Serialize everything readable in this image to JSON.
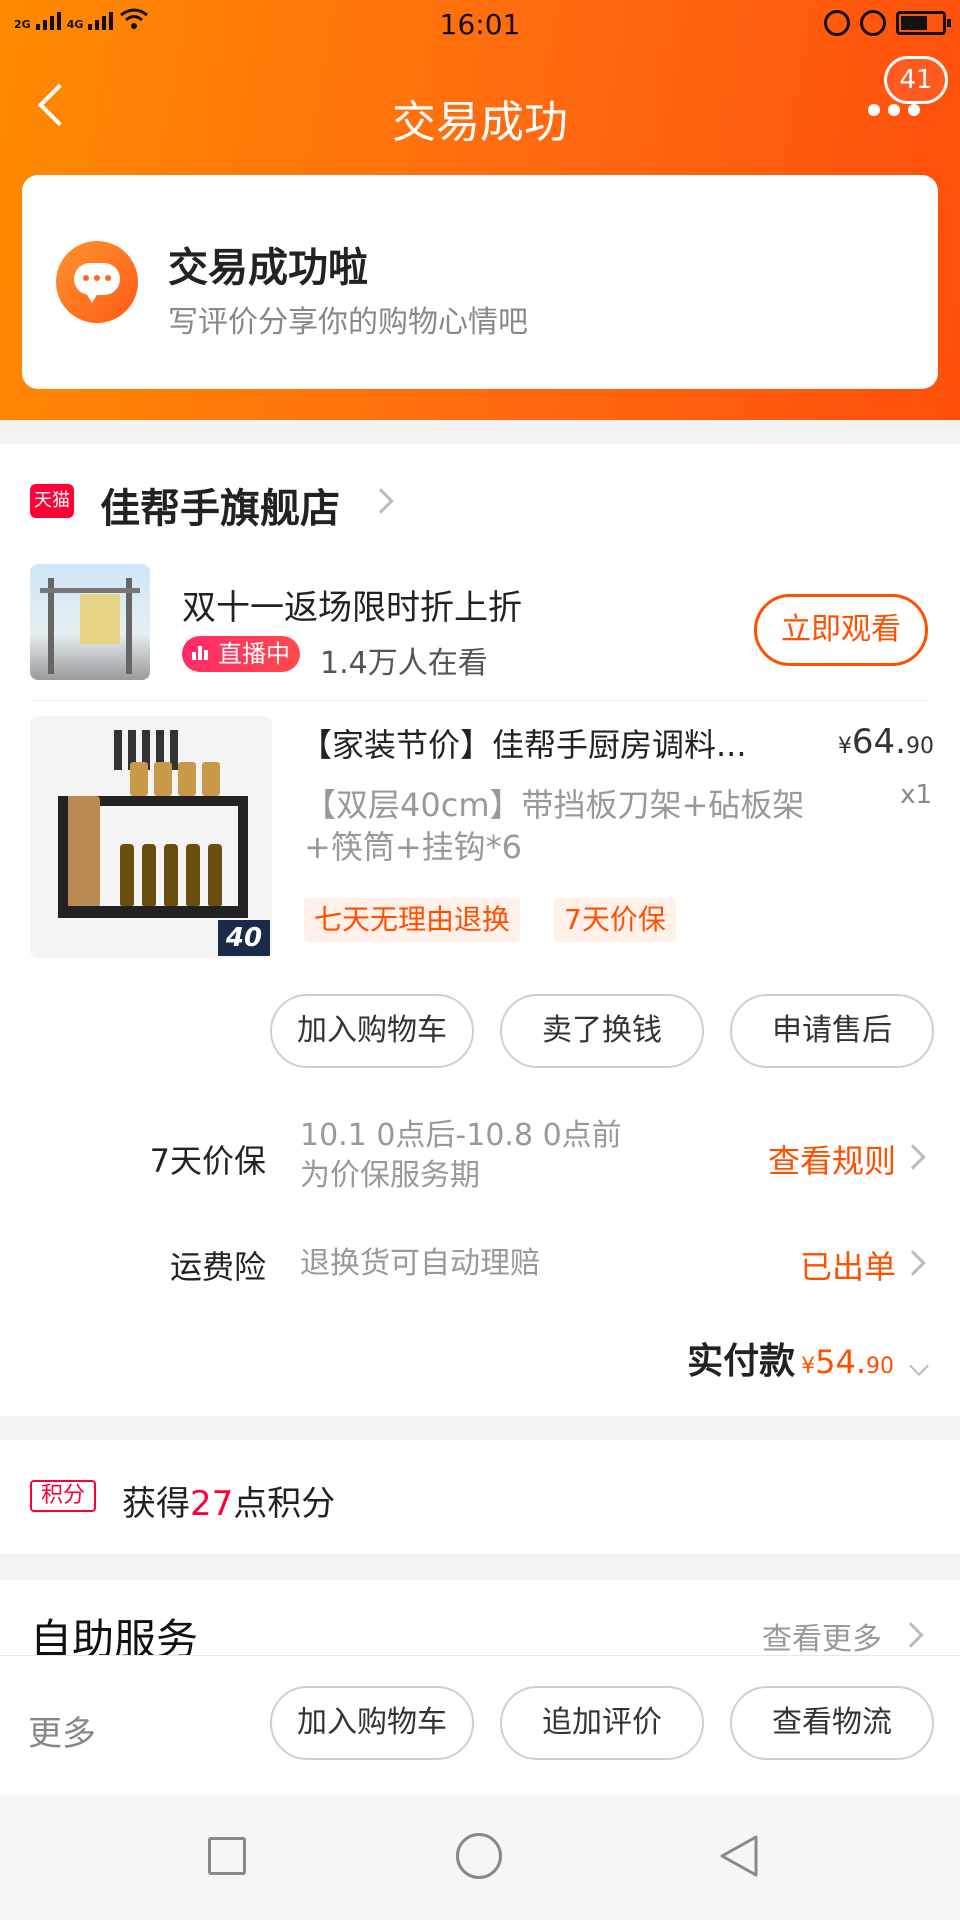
{
  "status_bar": {
    "network_1": "2G",
    "network_2": "4G",
    "time": "16:01"
  },
  "nav": {
    "title": "交易成功",
    "badge": "41"
  },
  "success": {
    "title": "交易成功啦",
    "subtitle": "写评价分享你的购物心情吧"
  },
  "store": {
    "logo": "天猫",
    "name": "佳帮手旗舰店"
  },
  "live": {
    "title": "双十一返场限时折上折",
    "tag": "直播中",
    "watchers": "1.4万人在看",
    "button": "立即观看"
  },
  "product": {
    "title": "【家装节价】佳帮手厨房调料...",
    "price_symbol": "¥",
    "price_int": "64.",
    "price_dec": "90",
    "qty": "x1",
    "sku": "【双层40cm】带挡板刀架+砧板架+筷筒+挂钩*6",
    "image_label": "40",
    "tags": [
      "七天无理由退换",
      "7天价保"
    ]
  },
  "item_actions": [
    "加入购物车",
    "卖了换钱",
    "申请售后"
  ],
  "services": [
    {
      "label": "7天价保",
      "desc": "10.1 0点后-10.8 0点前为价保服务期",
      "link": "查看规则"
    },
    {
      "label": "运费险",
      "desc": "退换货可自动理赔",
      "link": "已出单"
    }
  ],
  "paid": {
    "label": "实付款",
    "symbol": "¥",
    "int": "54.",
    "dec": "90"
  },
  "points": {
    "icon": "积分",
    "prefix": "获得",
    "num": "27",
    "suffix": "点积分"
  },
  "self_service": {
    "title": "自助服务",
    "more": "查看更多"
  },
  "bottom_bar": {
    "more": "更多",
    "buttons": [
      "加入购物车",
      "追加评价",
      "查看物流"
    ]
  },
  "colors": {
    "accent": "#ff5000",
    "header_start": "#ff8a00",
    "header_end": "#ff4e0c",
    "tmall_red": "#ff0036"
  }
}
